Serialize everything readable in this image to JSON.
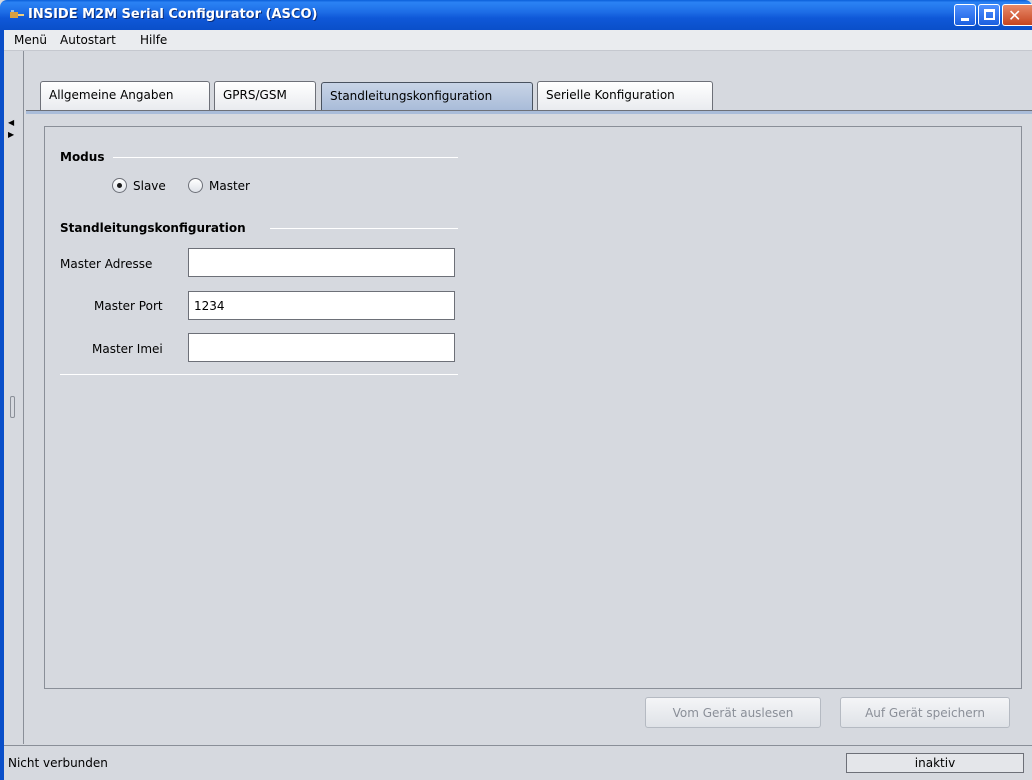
{
  "window": {
    "title": "INSIDE M2M Serial Configurator (ASCO)",
    "icon": "app-icon",
    "controls": {
      "minimize": "minimize-icon",
      "maximize": "maximize-icon",
      "close": "close-icon"
    }
  },
  "menu": {
    "items": [
      {
        "label": "Menü"
      },
      {
        "label": "Autostart"
      },
      {
        "label": "Hilfe"
      }
    ]
  },
  "tabs": [
    {
      "label": "Allgemeine Angaben",
      "active": false
    },
    {
      "label": "GPRS/GSM",
      "active": false
    },
    {
      "label": "Standleitungskonfiguration",
      "active": true
    },
    {
      "label": "Serielle Konfiguration",
      "active": false
    }
  ],
  "modus": {
    "title": "Modus",
    "options": [
      {
        "label": "Slave",
        "selected": true
      },
      {
        "label": "Master",
        "selected": false
      }
    ]
  },
  "standleitung": {
    "title": "Standleitungskonfiguration",
    "fields": [
      {
        "label": "Master Adresse",
        "value": ""
      },
      {
        "label": "Master Port",
        "value": "1234"
      },
      {
        "label": "Master Imei",
        "value": ""
      }
    ]
  },
  "actions": {
    "read_label": "Vom Gerät auslesen",
    "save_label": "Auf Gerät speichern"
  },
  "status": {
    "connection": "Nicht verbunden",
    "state": "inaktiv"
  },
  "colors": {
    "titlebar": "#0a5fd9",
    "active_tab": "#a9bcd9",
    "background": "#d6d9df"
  }
}
